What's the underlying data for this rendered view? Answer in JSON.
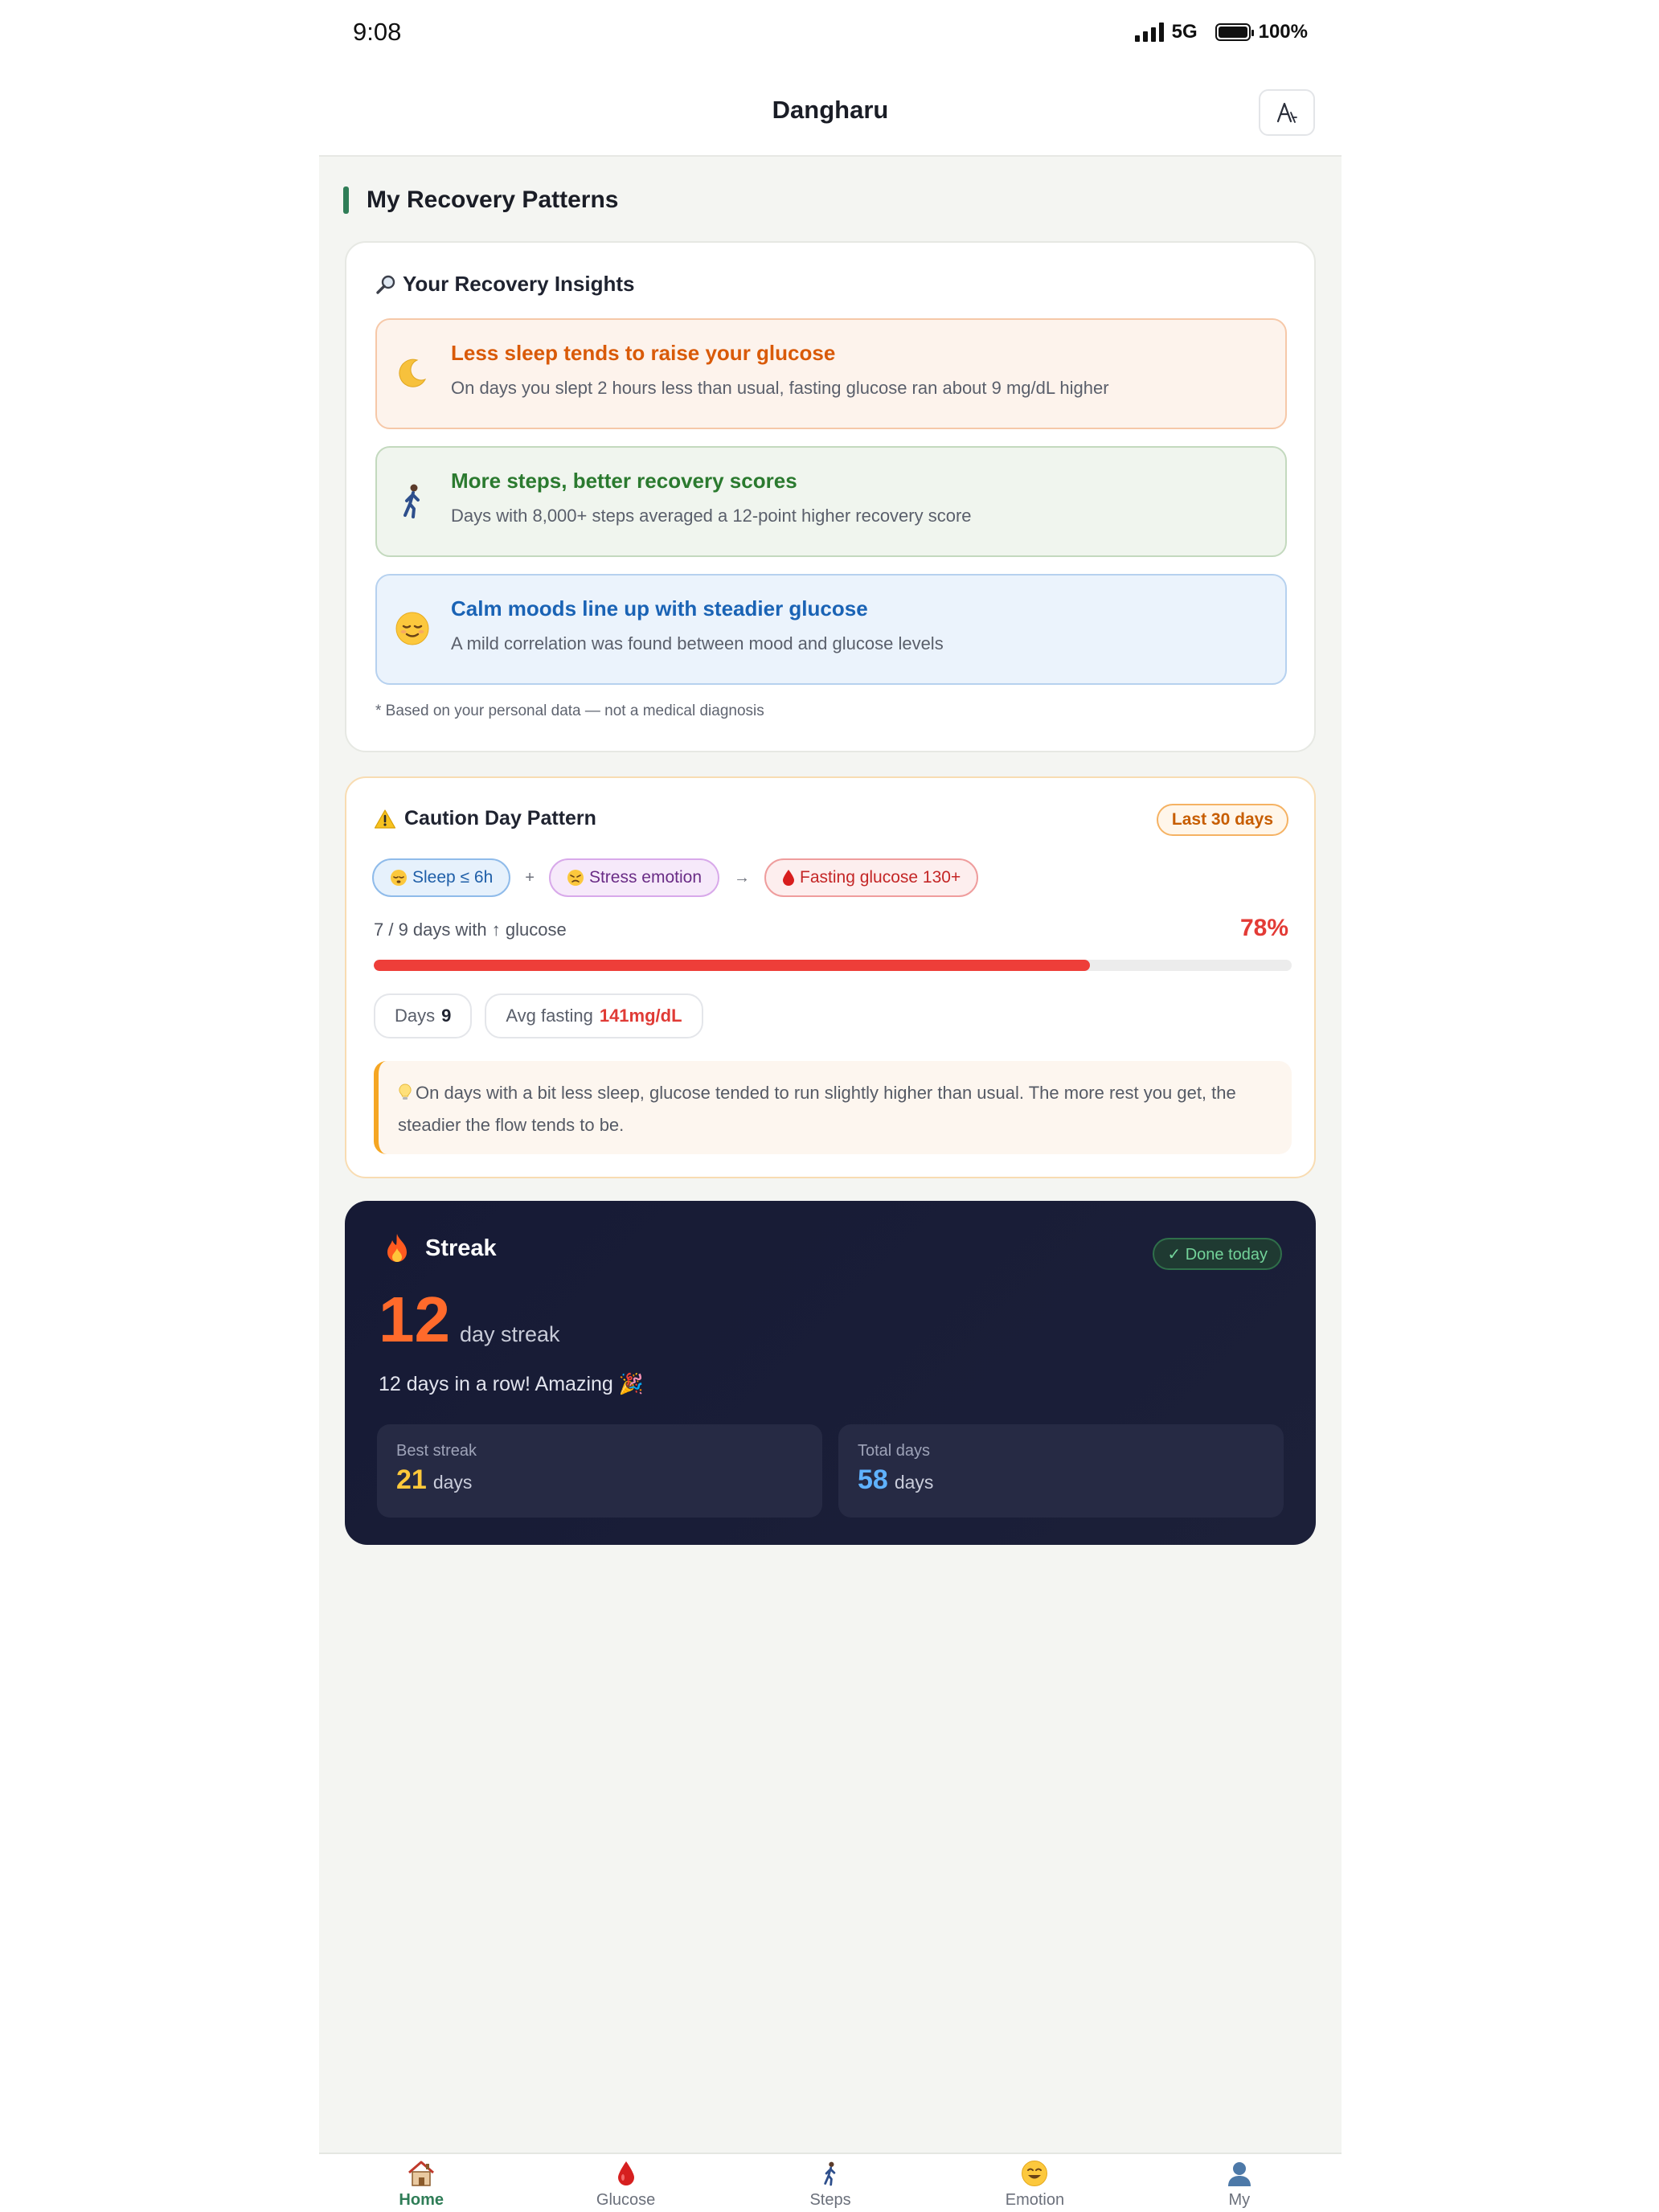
{
  "status_bar": {
    "time": "9:08",
    "network": "5G",
    "battery": "100%"
  },
  "header": {
    "title": "Dangharu",
    "font_button_icon": "font-size-icon"
  },
  "section": {
    "title": "My Recovery Patterns"
  },
  "insights": {
    "title": "Your Recovery Insights",
    "title_icon": "magnifier-icon",
    "items": [
      {
        "icon": "moon-icon",
        "title": "Less sleep tends to raise your glucose",
        "desc": "On days you slept 2 hours less than usual, fasting glucose ran about 9 mg/dL higher",
        "accent": "#d95a08"
      },
      {
        "icon": "walking-icon",
        "title": "More steps, better recovery scores",
        "desc": "Days with 8,000+ steps averaged a 12-point higher recovery score",
        "accent": "#2b7a2f"
      },
      {
        "icon": "relieved-face-icon",
        "title": "Calm moods line up with steadier glucose",
        "desc": "A mild correlation was found between mood and glucose levels",
        "accent": "#1a63b5"
      }
    ],
    "footnote": "* Based on your personal data — not a medical diagnosis"
  },
  "caution": {
    "title": "Caution Day Pattern",
    "title_icon": "warning-icon",
    "range": "Last 30 days",
    "chips": {
      "sleep": "Sleep ≤ 6h",
      "plus": "+",
      "stress": "Stress emotion",
      "arrow": "→",
      "glucose": "Fasting glucose 130+"
    },
    "days_text": "7 / 9 days with ↑ glucose",
    "percent": "78%",
    "progress_fraction": 0.78,
    "days_label": "Days",
    "days_value": "9",
    "avg_label": "Avg fasting",
    "avg_value": "141mg/dL",
    "tip": "On days with a bit less sleep, glucose tended to run slightly higher than usual. The more rest you get, the steadier the flow tends to be."
  },
  "streak": {
    "title": "Streak",
    "done_badge": "✓ Done today",
    "count": "12",
    "count_unit": "day streak",
    "message": "12 days in a row! Amazing 🎉",
    "best_label": "Best streak",
    "best_value": "21",
    "best_unit": "days",
    "total_label": "Total days",
    "total_value": "58",
    "total_unit": "days",
    "accent": "#ff6a2b"
  },
  "nav": [
    {
      "label": "Home",
      "icon": "home-icon",
      "active": true
    },
    {
      "label": "Glucose",
      "icon": "blood-drop-icon",
      "active": false
    },
    {
      "label": "Steps",
      "icon": "walking-icon",
      "active": false
    },
    {
      "label": "Emotion",
      "icon": "smiley-icon",
      "active": false
    },
    {
      "label": "My",
      "icon": "user-icon",
      "active": false
    }
  ]
}
